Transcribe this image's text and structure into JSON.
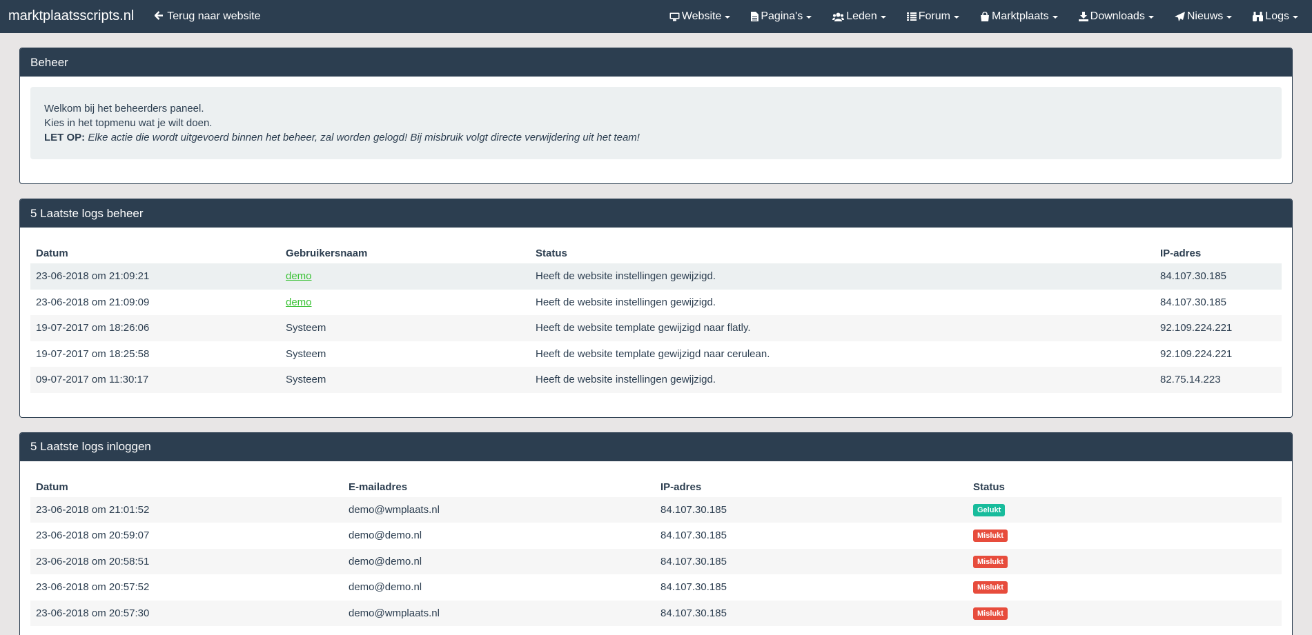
{
  "navbar": {
    "brand": "marktplaatsscripts.nl",
    "back_link": "Terug naar website",
    "menu": [
      {
        "label": "Website",
        "icon": "monitor-icon"
      },
      {
        "label": "Pagina's",
        "icon": "file-icon"
      },
      {
        "label": "Leden",
        "icon": "users-icon"
      },
      {
        "label": "Forum",
        "icon": "list-icon"
      },
      {
        "label": "Marktplaats",
        "icon": "shopping-bag-icon"
      },
      {
        "label": "Downloads",
        "icon": "download-icon"
      },
      {
        "label": "Nieuws",
        "icon": "paper-plane-icon"
      },
      {
        "label": "Logs",
        "icon": "binoculars-icon"
      }
    ]
  },
  "beheer": {
    "title": "Beheer",
    "line1": "Welkom bij het beheerders paneel.",
    "line2": "Kies in het topmenu wat je wilt doen.",
    "warning_label": "LET OP:",
    "warning_text": "Elke actie die wordt uitgevoerd binnen het beheer, zal worden gelogd! Bij misbruik volgt directe verwijdering uit het team!"
  },
  "logs_beheer": {
    "title": "5 Laatste logs beheer",
    "headers": [
      "Datum",
      "Gebruikersnaam",
      "Status",
      "IP-adres"
    ],
    "rows": [
      {
        "date": "23-06-2018 om 21:09:21",
        "user": "demo",
        "status": "Heeft de website instellingen gewijzigd.",
        "ip": "84.107.30.185"
      },
      {
        "date": "23-06-2018 om 21:09:09",
        "user": "demo",
        "status": "Heeft de website instellingen gewijzigd.",
        "ip": "84.107.30.185"
      },
      {
        "date": "19-07-2017 om 18:26:06",
        "user": "Systeem",
        "status": "Heeft de website template gewijzigd naar flatly.",
        "ip": "92.109.224.221"
      },
      {
        "date": "19-07-2017 om 18:25:58",
        "user": "Systeem",
        "status": "Heeft de website template gewijzigd naar cerulean.",
        "ip": "92.109.224.221"
      },
      {
        "date": "09-07-2017 om 11:30:17",
        "user": "Systeem",
        "status": "Heeft de website instellingen gewijzigd.",
        "ip": "82.75.14.223"
      }
    ]
  },
  "logs_inloggen": {
    "title": "5 Laatste logs inloggen",
    "headers": [
      "Datum",
      "E-mailadres",
      "IP-adres",
      "Status"
    ],
    "rows": [
      {
        "date": "23-06-2018 om 21:01:52",
        "email": "demo@wmplaats.nl",
        "ip": "84.107.30.185",
        "status": "Gelukt"
      },
      {
        "date": "23-06-2018 om 20:59:07",
        "email": "demo@demo.nl",
        "ip": "84.107.30.185",
        "status": "Mislukt"
      },
      {
        "date": "23-06-2018 om 20:58:51",
        "email": "demo@demo.nl",
        "ip": "84.107.30.185",
        "status": "Mislukt"
      },
      {
        "date": "23-06-2018 om 20:57:52",
        "email": "demo@demo.nl",
        "ip": "84.107.30.185",
        "status": "Mislukt"
      },
      {
        "date": "23-06-2018 om 20:57:30",
        "email": "demo@wmplaats.nl",
        "ip": "84.107.30.185",
        "status": "Mislukt"
      }
    ]
  },
  "colors": {
    "navbar": "#2c3e50",
    "success": "#18bc9c",
    "danger": "#e74c3c",
    "link": "#3bc236"
  }
}
